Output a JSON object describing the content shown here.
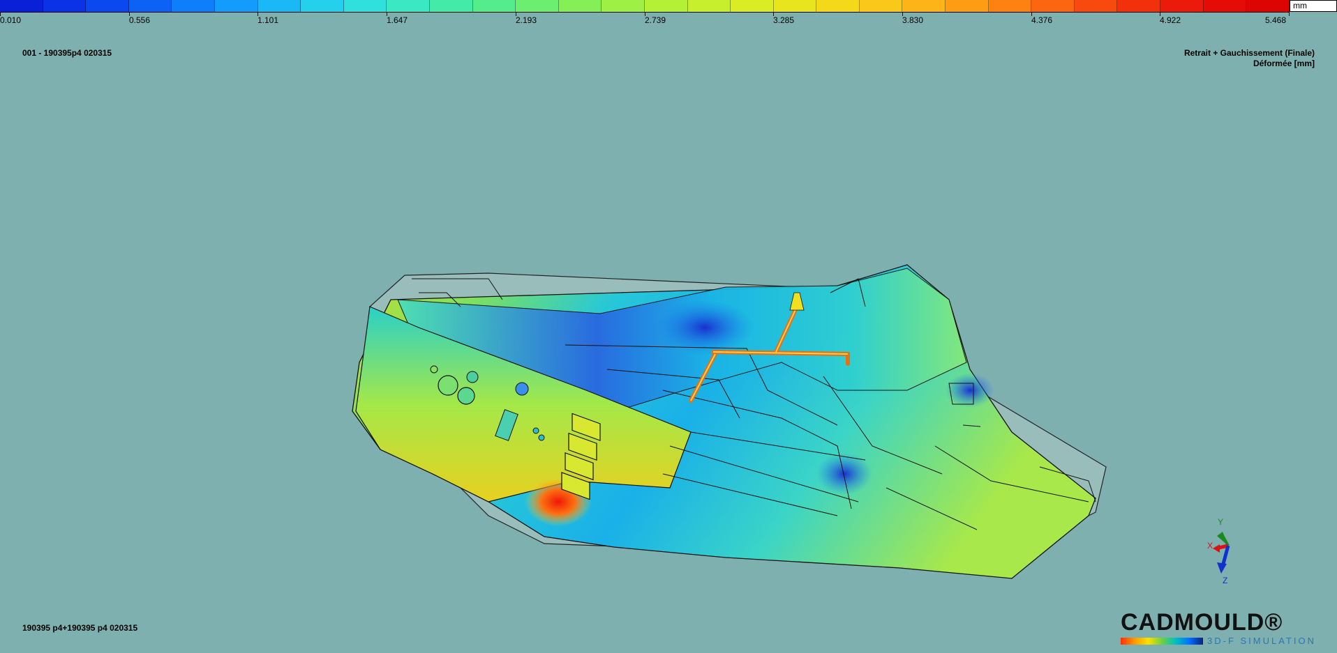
{
  "legend": {
    "unit": "mm",
    "ticks": [
      "0.010",
      "0.556",
      "1.101",
      "1.647",
      "2.193",
      "2.739",
      "3.285",
      "3.830",
      "4.376",
      "4.922",
      "5.468"
    ],
    "colors": [
      "#0a1fd8",
      "#0b32e6",
      "#0c48f0",
      "#0d62f6",
      "#0f7efa",
      "#139cfb",
      "#1ab8f6",
      "#24d0ec",
      "#2fe0dc",
      "#3ae8c4",
      "#44eaa8",
      "#55ec8c",
      "#6cee70",
      "#86ef58",
      "#9ef044",
      "#b4f036",
      "#c8ef2c",
      "#daec24",
      "#e8e41e",
      "#f4d81a",
      "#fac818",
      "#fdb416",
      "#fe9c14",
      "#fe8212",
      "#fc6610",
      "#f84a0e",
      "#f2300c",
      "#ec1a0a",
      "#e50c08",
      "#dd0404"
    ]
  },
  "header": {
    "left_label": "001 - 190395p4 020315",
    "result_title": "Retrait + Gauchissement (Finale)",
    "result_subtitle": "Déformée [mm]"
  },
  "footer": {
    "model_name": "190395 p4+190395 p4 020315"
  },
  "triad": {
    "x": "X",
    "y": "Y",
    "z": "Z"
  },
  "logo": {
    "name": "CADMOULD®",
    "tagline": "3D-F SIMULATION"
  }
}
